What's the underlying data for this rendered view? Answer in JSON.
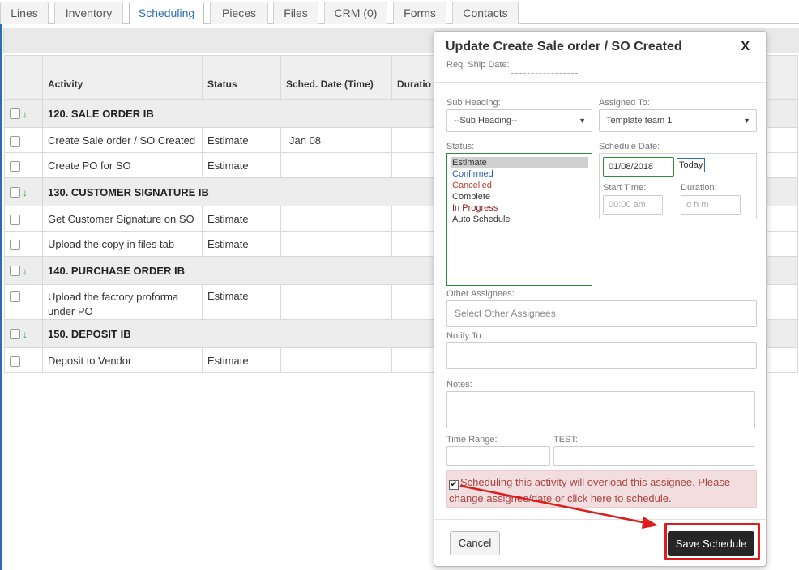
{
  "tabs": [
    {
      "label": "Lines"
    },
    {
      "label": "Inventory"
    },
    {
      "label": "Scheduling"
    },
    {
      "label": "Pieces"
    },
    {
      "label": "Files"
    },
    {
      "label": "CRM (0)"
    },
    {
      "label": "Forms"
    },
    {
      "label": "Contacts"
    }
  ],
  "active_tab": "Scheduling",
  "table": {
    "headers": [
      "Activity",
      "Status",
      "Sched. Date (Time)",
      "Duratio"
    ],
    "groups": [
      {
        "label": "120. SALE ORDER IB",
        "rows": [
          {
            "activity": "Create Sale order / SO Created",
            "status": "Estimate",
            "date": "Jan 08"
          },
          {
            "activity": "Create PO for SO",
            "status": "Estimate",
            "date": ""
          }
        ]
      },
      {
        "label": "130. CUSTOMER SIGNATURE IB",
        "rows": [
          {
            "activity": "Get Customer Signature on SO",
            "status": "Estimate",
            "date": ""
          },
          {
            "activity": "Upload the copy in files tab",
            "status": "Estimate",
            "date": ""
          }
        ]
      },
      {
        "label": "140. PURCHASE ORDER IB",
        "rows": [
          {
            "activity": "Upload the factory proforma under PO",
            "status": "Estimate",
            "date": ""
          }
        ]
      },
      {
        "label": "150. DEPOSIT IB",
        "rows": [
          {
            "activity": "Deposit to Vendor",
            "status": "Estimate",
            "date": ""
          }
        ]
      }
    ]
  },
  "modal": {
    "title": "Update Create Sale order / SO Created",
    "close": "X",
    "req_ship_label": "Req. Ship Date:",
    "sub_heading_label": "Sub Heading:",
    "sub_heading_value": "--Sub Heading--",
    "assigned_label": "Assigned To:",
    "assigned_value": "Template team 1",
    "status_label": "Status:",
    "status_options": [
      {
        "label": "Estimate",
        "color": "#333333"
      },
      {
        "label": "Confirmed",
        "color": "#2a5db0"
      },
      {
        "label": "Cancelled",
        "color": "#c0392b"
      },
      {
        "label": "Complete",
        "color": "#333333"
      },
      {
        "label": "In Progress",
        "color": "#8b2020"
      },
      {
        "label": "Auto Schedule",
        "color": "#333333"
      }
    ],
    "schedule_date_label": "Schedule Date:",
    "schedule_date_value": "01/08/2018",
    "today_label": "Today",
    "start_time_label": "Start Time:",
    "start_time_placeholder": "00:00 am",
    "duration_label": "Duration:",
    "duration_placeholder": "d h m",
    "other_assignees_label": "Other Assignees:",
    "other_assignees_placeholder": "Select Other Assignees",
    "notify_label": "Notify To:",
    "notes_label": "Notes:",
    "time_range_label": "Time Range:",
    "test_label": "TEST:",
    "warning": "Scheduling this activity will overload this assignee. Please change assignee/date or click here to schedule.",
    "cancel_label": "Cancel",
    "save_label": "Save Schedule"
  },
  "colors": {
    "accent": "#2a6fb5",
    "highlight": "#e01b1b",
    "alert_bg": "#f2dede",
    "alert_text": "#a94442"
  }
}
